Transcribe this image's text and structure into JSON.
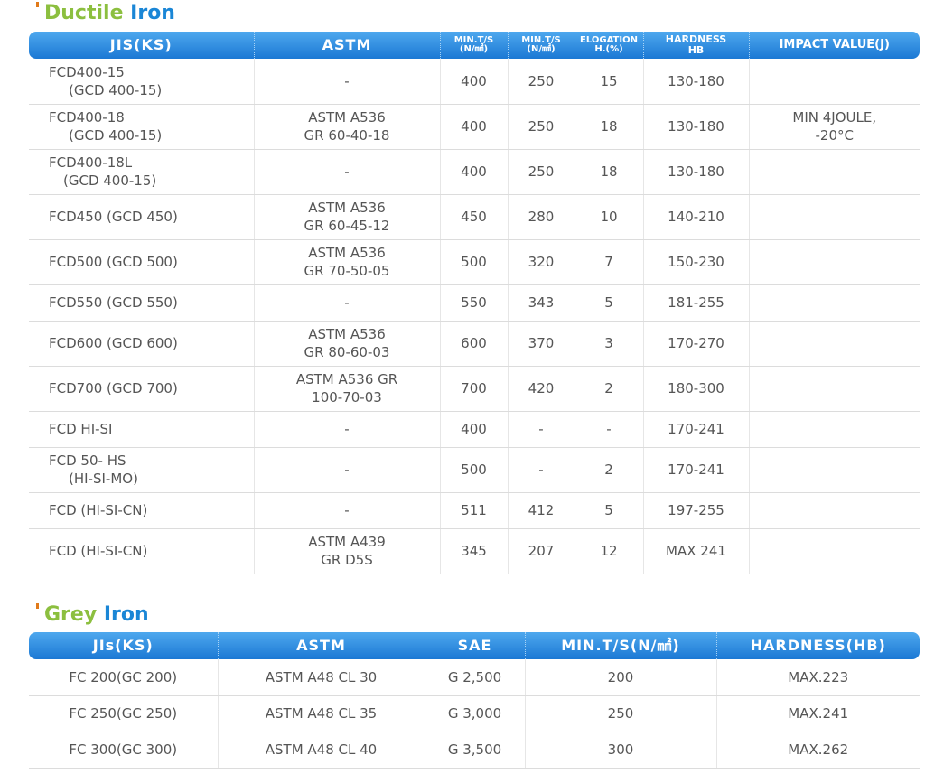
{
  "ductile": {
    "title_part1": "Ductile",
    "title_part2": "Iron",
    "headers": {
      "jis": "JIS(KS)",
      "astm": "ASTM",
      "min_ts_1": "MIN.T/S",
      "min_ts_1_unit": "(N/㎟)",
      "min_ts_2": "MIN.T/S",
      "min_ts_2_unit": "(N/㎟)",
      "elogation": "ELOGATION",
      "elogation_unit": "H.(%)",
      "hardness": "HARDNESS",
      "hardness_unit": "HB",
      "impact": "IMPACT VALUE(J)"
    },
    "rows": [
      {
        "jis1": "FCD400-15",
        "jis2": "(GCD 400-15)",
        "astm1": "-",
        "astm2": "",
        "ts1": "400",
        "ts2": "250",
        "el": "15",
        "hb": "130-180",
        "imp1": "",
        "imp2": ""
      },
      {
        "jis1": "FCD400-18",
        "jis2": "(GCD 400-15)",
        "astm1": "ASTM A536",
        "astm2": "GR 60-40-18",
        "ts1": "400",
        "ts2": "250",
        "el": "18",
        "hb": "130-180",
        "imp1": "MIN 4JOULE,",
        "imp2": "-20°C"
      },
      {
        "jis1": "FCD400-18L",
        "jis2": "(GCD 400-15)",
        "astm1": "-",
        "astm2": "",
        "ts1": "400",
        "ts2": "250",
        "el": "18",
        "hb": "130-180",
        "imp1": "",
        "imp2": ""
      },
      {
        "jis1": "FCD450 (GCD 450)",
        "jis2": "",
        "astm1": "ASTM A536",
        "astm2": "GR 60-45-12",
        "ts1": "450",
        "ts2": "280",
        "el": "10",
        "hb": "140-210",
        "imp1": "",
        "imp2": ""
      },
      {
        "jis1": "FCD500 (GCD 500)",
        "jis2": "",
        "astm1": "ASTM A536",
        "astm2": "GR 70-50-05",
        "ts1": "500",
        "ts2": "320",
        "el": "7",
        "hb": "150-230",
        "imp1": "",
        "imp2": ""
      },
      {
        "jis1": "FCD550 (GCD 550)",
        "jis2": "",
        "astm1": "-",
        "astm2": "",
        "ts1": "550",
        "ts2": "343",
        "el": "5",
        "hb": "181-255",
        "imp1": "",
        "imp2": ""
      },
      {
        "jis1": "FCD600 (GCD 600)",
        "jis2": "",
        "astm1": "ASTM A536",
        "astm2": "GR 80-60-03",
        "ts1": "600",
        "ts2": "370",
        "el": "3",
        "hb": "170-270",
        "imp1": "",
        "imp2": ""
      },
      {
        "jis1": "FCD700 (GCD 700)",
        "jis2": "",
        "astm1": "ASTM A536 GR",
        "astm2": "100-70-03",
        "ts1": "700",
        "ts2": "420",
        "el": "2",
        "hb": "180-300",
        "imp1": "",
        "imp2": ""
      },
      {
        "jis1": "FCD HI-SI",
        "jis2": "",
        "astm1": "-",
        "astm2": "",
        "ts1": "400",
        "ts2": "-",
        "el": "-",
        "hb": "170-241",
        "imp1": "",
        "imp2": ""
      },
      {
        "jis1": "FCD 50- HS",
        "jis2": "(HI-SI-MO)",
        "astm1": "-",
        "astm2": "",
        "ts1": "500",
        "ts2": "-",
        "el": "2",
        "hb": "170-241",
        "imp1": "",
        "imp2": ""
      },
      {
        "jis1": "FCD (HI-SI-CN)",
        "jis2": "",
        "astm1": "-",
        "astm2": "",
        "ts1": "511",
        "ts2": "412",
        "el": "5",
        "hb": "197-255",
        "imp1": "",
        "imp2": ""
      },
      {
        "jis1": "FCD (HI-SI-CN)",
        "jis2": "",
        "astm1": "ASTM A439",
        "astm2": "GR D5S",
        "ts1": "345",
        "ts2": "207",
        "el": "12",
        "hb": "MAX 241",
        "imp1": "",
        "imp2": ""
      }
    ]
  },
  "grey": {
    "title_part1": "Grey",
    "title_part2": "Iron",
    "headers": {
      "jis": "JIs(KS)",
      "astm": "ASTM",
      "sae": "SAE",
      "min_ts": "MIN.T/S(N/㎟)",
      "hardness": "HARDNESS(HB)"
    },
    "rows": [
      {
        "jis": "FC 200(GC 200)",
        "astm": "ASTM A48 CL 30",
        "sae": "G 2,500",
        "ts": "200",
        "hb": "MAX.223"
      },
      {
        "jis": "FC 250(GC 250)",
        "astm": "ASTM A48 CL 35",
        "sae": "G 3,000",
        "ts": "250",
        "hb": "MAX.241"
      },
      {
        "jis": "FC 300(GC 300)",
        "astm": "ASTM A48 CL 40",
        "sae": "G 3,500",
        "ts": "300",
        "hb": "MAX.262"
      }
    ]
  }
}
